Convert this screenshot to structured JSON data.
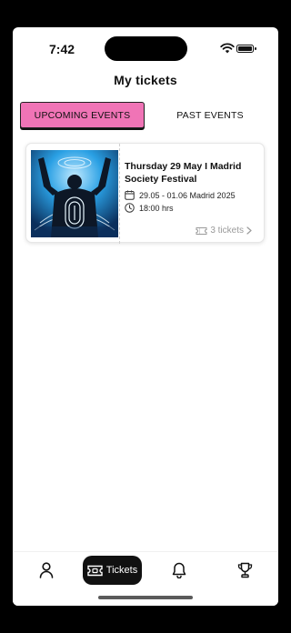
{
  "status_bar": {
    "time": "7:42"
  },
  "page": {
    "title": "My tickets"
  },
  "tabs": [
    {
      "label": "UPCOMING EVENTS",
      "active": true
    },
    {
      "label": "PAST EVENTS",
      "active": false
    }
  ],
  "ticket": {
    "date_line": "Thursday 29  May I Madrid",
    "event_name": "Society Festival",
    "dates": "29.05 - 01.06 Madrid 2025",
    "time": "18:00 hrs",
    "tickets_count": "3 tickets"
  },
  "nav": {
    "tickets_label": "Tickets"
  },
  "colors": {
    "active_tab": "#f074b6",
    "nav_active": "#111111",
    "event_image_blue": "#2aa0e4"
  },
  "icons": [
    "wifi-icon",
    "battery-icon",
    "calendar-icon",
    "clock-icon",
    "ticket-icon",
    "chevron-right-icon",
    "profile-icon",
    "notification-bell-icon",
    "trophy-icon"
  ]
}
